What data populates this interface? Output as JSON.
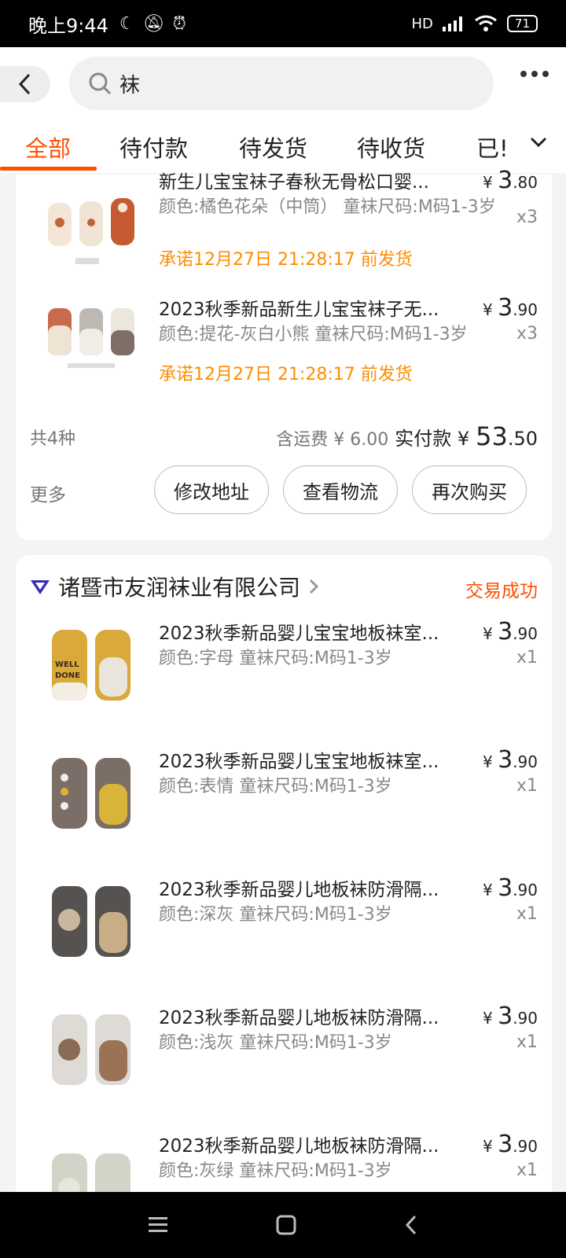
{
  "status_bar": {
    "time": "晚上9:44",
    "battery": "71",
    "network": "HD"
  },
  "search": {
    "query": "袜"
  },
  "tabs": [
    "全部",
    "待付款",
    "待发货",
    "待收货",
    "已!"
  ],
  "order1": {
    "items": [
      {
        "title": "新生儿宝宝袜子春秋无骨松口婴...",
        "price_symbol": "¥",
        "price_int": "3",
        "price_dec": ".80",
        "spec": "颜色:橘色花朵（中筒） 童袜尺码:M码1-3岁",
        "qty": "x3",
        "promise": "承诺12月27日 21:28:17 前发货"
      },
      {
        "title": "2023秋季新品新生儿宝宝袜子无...",
        "price_symbol": "¥",
        "price_int": "3",
        "price_dec": ".90",
        "spec": "颜色:提花-灰白小熊 童袜尺码:M码1-3岁",
        "qty": "x3",
        "promise": "承诺12月27日 21:28:17 前发货"
      }
    ],
    "summary": {
      "count": "共4种",
      "shipping": "含运费 ¥ 6.00",
      "paid_label": "实付款 ¥",
      "paid_int": "53",
      "paid_dec": ".50"
    },
    "more": "更多",
    "buttons": [
      "修改地址",
      "查看物流",
      "再次购买"
    ]
  },
  "order2": {
    "shop": "诸暨市友润袜业有限公司",
    "status": "交易成功",
    "items": [
      {
        "title": "2023秋季新品婴儿宝宝地板袜室...",
        "price_symbol": "¥",
        "price_int": "3",
        "price_dec": ".90",
        "spec": "颜色:字母 童袜尺码:M码1-3岁",
        "qty": "x1"
      },
      {
        "title": "2023秋季新品婴儿宝宝地板袜室...",
        "price_symbol": "¥",
        "price_int": "3",
        "price_dec": ".90",
        "spec": "颜色:表情 童袜尺码:M码1-3岁",
        "qty": "x1"
      },
      {
        "title": "2023秋季新品婴儿地板袜防滑隔...",
        "price_symbol": "¥",
        "price_int": "3",
        "price_dec": ".90",
        "spec": "颜色:深灰 童袜尺码:M码1-3岁",
        "qty": "x1"
      },
      {
        "title": "2023秋季新品婴儿地板袜防滑隔...",
        "price_symbol": "¥",
        "price_int": "3",
        "price_dec": ".90",
        "spec": "颜色:浅灰 童袜尺码:M码1-3岁",
        "qty": "x1"
      },
      {
        "title": "2023秋季新品婴儿地板袜防滑隔...",
        "price_symbol": "¥",
        "price_int": "3",
        "price_dec": ".90",
        "spec": "颜色:灰绿 童袜尺码:M码1-3岁",
        "qty": "x1"
      }
    ]
  },
  "colors": {
    "accent": "#ff5000",
    "promise": "#ff8c00"
  },
  "icons": [
    "moon-icon",
    "mute-icon",
    "alarm-icon",
    "signal-icon",
    "wifi-icon",
    "battery-icon",
    "back-icon",
    "search-icon",
    "more-icon",
    "chevron-down-icon",
    "shop-badge-icon",
    "chevron-right-icon",
    "menu-icon",
    "home-icon",
    "back-nav-icon"
  ]
}
